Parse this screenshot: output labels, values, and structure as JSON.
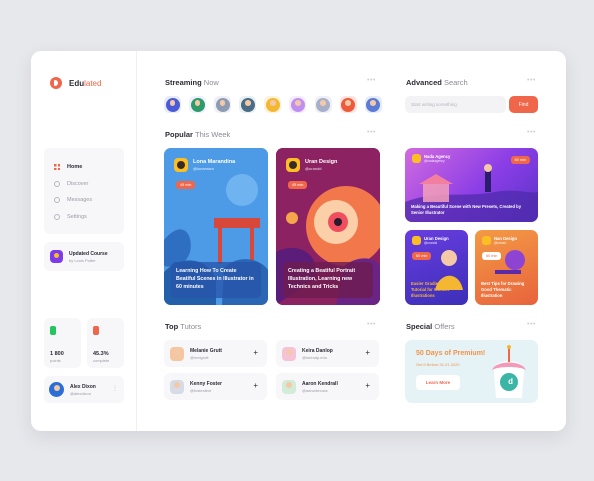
{
  "brand": {
    "name_bold": "Edu",
    "name_light": "lated",
    "accent": "#f0664a"
  },
  "nav": {
    "items": [
      {
        "label": "Home",
        "icon": "home-grid-icon",
        "active": true
      },
      {
        "label": "Discover",
        "icon": "compass-icon",
        "active": false
      },
      {
        "label": "Messages",
        "icon": "message-icon",
        "active": false
      },
      {
        "label": "Settings",
        "icon": "gear-icon",
        "active": false
      }
    ]
  },
  "updated_course": {
    "title": "Updated Course",
    "author": "by Louis Potter"
  },
  "stats": [
    {
      "value": "1 800",
      "label": "points",
      "color": "#22c55e"
    },
    {
      "value": "45.3%",
      "label": "complete",
      "color": "#f0664a"
    }
  ],
  "profile": {
    "name": "Alex Dixon",
    "handle": "@alexdixon"
  },
  "streaming": {
    "title_bold": "Streaming",
    "title_light": "Now",
    "avatars": [
      "#4b5bd7",
      "#7a8cf0",
      "#8f9bb3",
      "#4a6d86",
      "#f4b731",
      "#c08ff0",
      "#a7b0c8",
      "#f05a3c",
      "#5b7bd6"
    ]
  },
  "popular": {
    "title_bold": "Popular",
    "title_light": "This Week",
    "cards": [
      {
        "name": "Lona Marandina",
        "user": "@lonamora",
        "badge": "45 min",
        "caption": "Learning How To Create Beatiful Scenes in Illustrator in 60 minutes"
      },
      {
        "name": "Uran Design",
        "user": "@urandd",
        "badge": "45 min",
        "caption": "Creating a Beatiful Portrait Illustration, Learning new Technics and Tricks"
      }
    ]
  },
  "tutors": {
    "title_bold": "Top",
    "title_light": "Tutors",
    "items": [
      {
        "name": "Melanie Grutt",
        "handle": "@melgrutt"
      },
      {
        "name": "Keira Danlop",
        "handle": "@keiradp.edu"
      },
      {
        "name": "Kenny Foster",
        "handle": "@fosterdive"
      },
      {
        "name": "Aaron Kendrall",
        "handle": "@aaronknows"
      }
    ]
  },
  "advanced_search": {
    "title_bold": "Advanced",
    "title_light": "Search",
    "placeholder": "Start writing something",
    "button": "Find",
    "cards": [
      {
        "name": "Nada Agency",
        "user": "@nadaagency",
        "badge": "60 min",
        "caption": "Making a Beautiful Scene with New Presets, Created by Senior Illustrator"
      },
      {
        "name": "Uran Design",
        "user": "@urandd",
        "badge": "60 min",
        "caption": "Easier Gradient Grand Tutorial for Wonder Illustrations"
      },
      {
        "name": "Nan Design",
        "user": "@nanart",
        "badge": "60 min",
        "caption": "Best Tips for Drawing Good Thematic Illustration"
      }
    ]
  },
  "special_offers": {
    "title_bold": "Special",
    "title_light": "Offers",
    "headline": "50 Days of Premium!",
    "sub": "Get it Before 01.01.2020",
    "button": "Learn More",
    "badge_letter": "d"
  }
}
